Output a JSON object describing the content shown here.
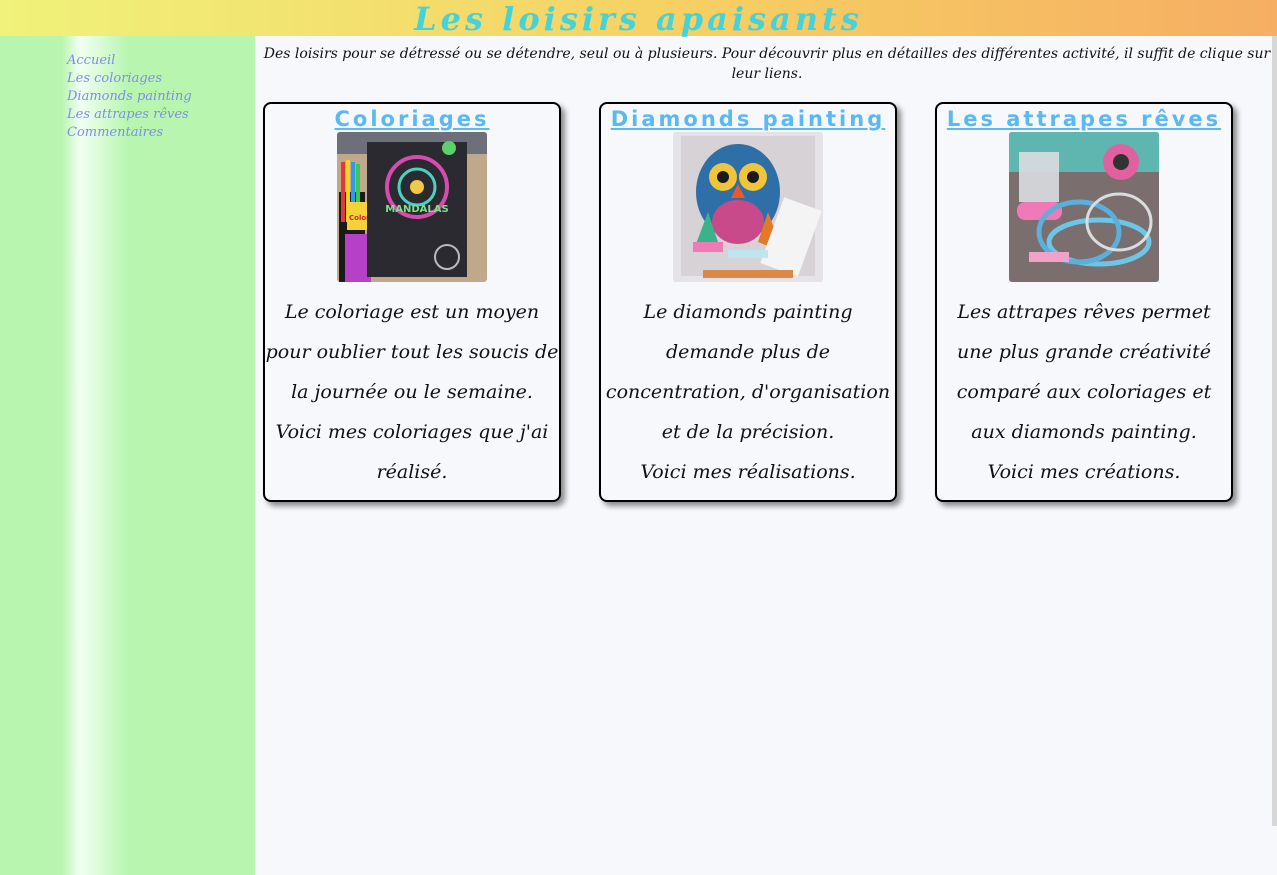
{
  "site": {
    "title": "Les loisirs apaisants"
  },
  "nav": [
    "Accueil",
    "Les coloriages",
    "Diamonds painting",
    "Les attrapes rêves",
    "Commentaires"
  ],
  "intro": "Des loisirs pour se détressé ou se détendre, seul ou à plusieurs. Pour découvrir plus en détailles des différentes activité, il suffit de clique sur leur liens.",
  "cards": [
    {
      "title": "Coloriages",
      "text": "Le coloriage est un moyen pour oublier tout les soucis de la journée ou le semaine.",
      "text2": "Voici mes coloriages que j'ai réalisé.",
      "image_labels": {
        "book": "MANDALAS",
        "pencils": "Color'Up!"
      }
    },
    {
      "title": "Diamonds painting",
      "text": "Le diamonds painting demande plus de concentration, d'organisation et de la précision.",
      "text2": "Voici mes réalisations."
    },
    {
      "title": "Les attrapes rêves",
      "text": "Les attrapes rêves permet une plus grande créativité comparé aux coloriages et aux diamonds painting.",
      "text2": "Voici mes créations."
    }
  ],
  "colors": {
    "header_gradient": [
      "#f0f27a",
      "#f6ae63"
    ],
    "title": "#45d3d9",
    "sidebar": "#b8f6b0",
    "nav_link": "#7f8de8",
    "card_title": "#5bb9f1"
  }
}
